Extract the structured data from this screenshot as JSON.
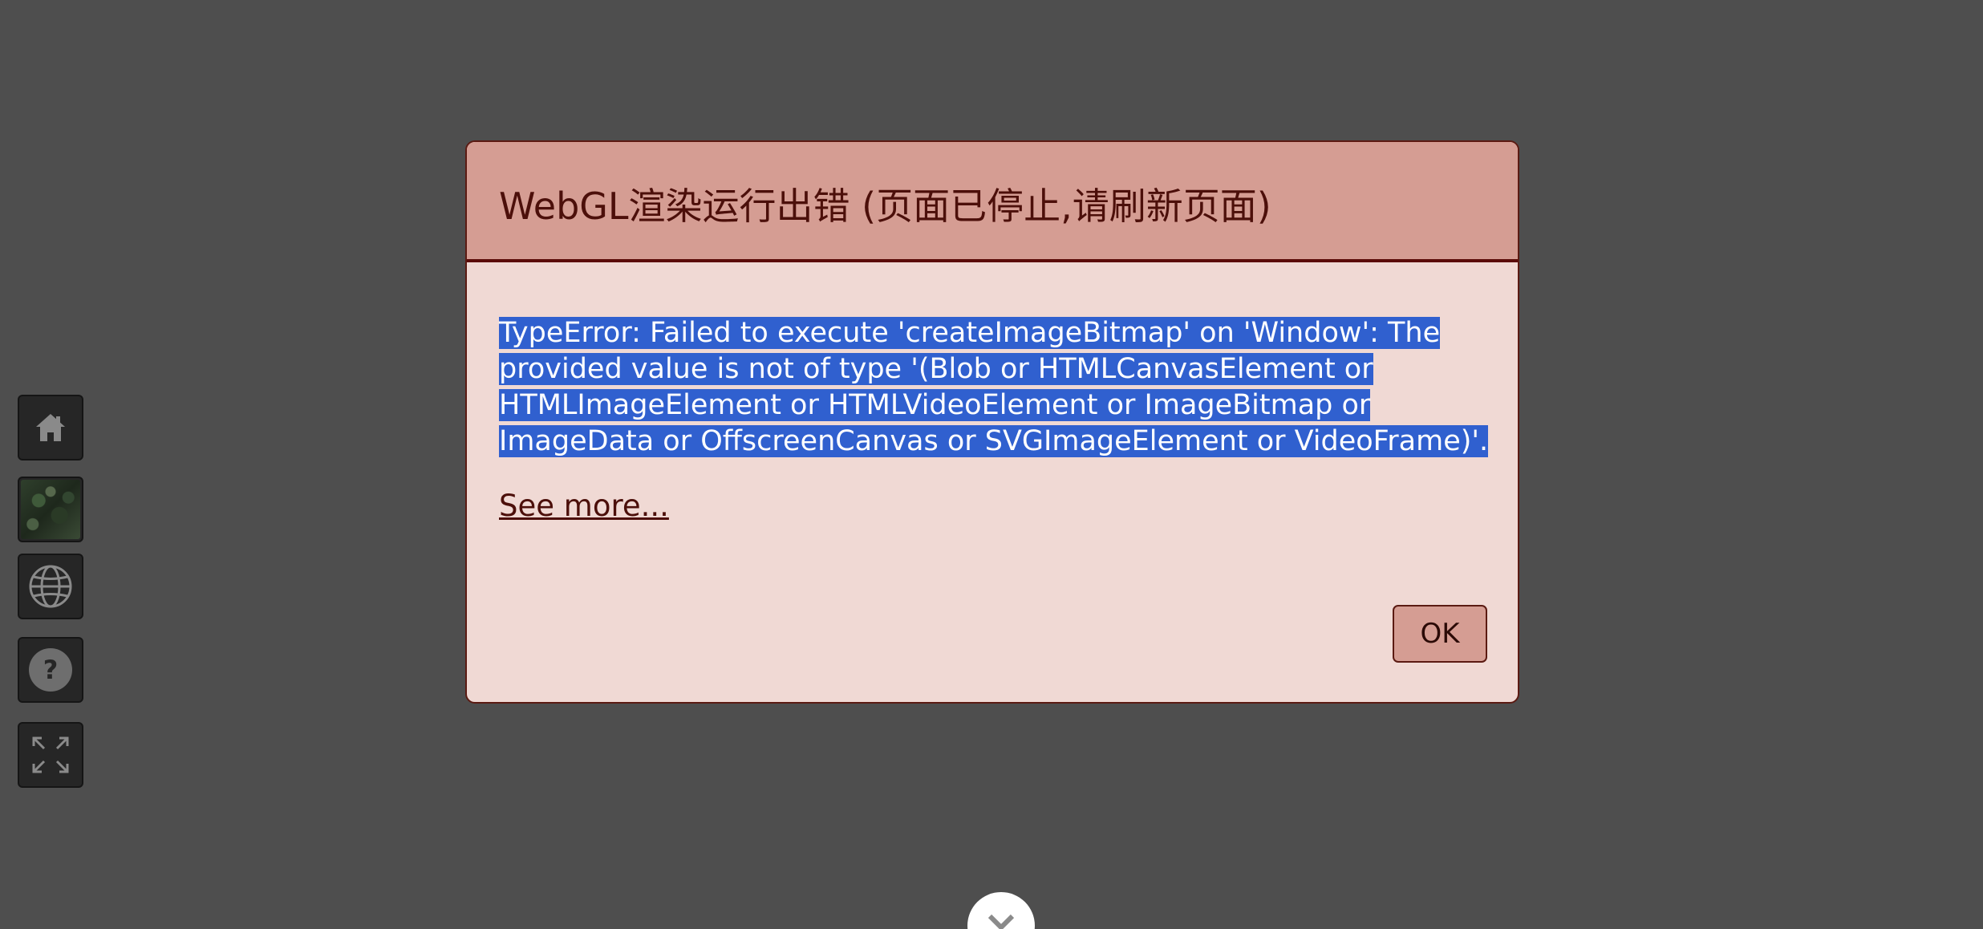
{
  "dialog": {
    "title": "WebGL渲染运行出错 (页面已停止,请刷新页面)",
    "error_message": "TypeError: Failed to execute 'createImageBitmap' on 'Window': The provided value is not of type '(Blob or HTMLCanvasElement or HTMLImageElement or HTMLVideoElement or ImageBitmap or ImageData or OffscreenCanvas or SVGImageElement or VideoFrame)'.",
    "see_more_label": "See more...",
    "ok_label": "OK"
  },
  "toolbar": {
    "items": [
      {
        "icon": "home-icon"
      },
      {
        "icon": "imagery-thumbnail"
      },
      {
        "icon": "globe-icon"
      },
      {
        "icon": "help-icon"
      },
      {
        "icon": "fullscreen-icon"
      }
    ]
  },
  "bottom_toggle": {
    "icon": "chevron-down-icon"
  },
  "colors": {
    "background": "#4e4e4e",
    "dialog_header": "#d59d93",
    "dialog_body": "#f0d9d4",
    "dialog_border": "#5b1a12",
    "selection": "#3060cf"
  }
}
